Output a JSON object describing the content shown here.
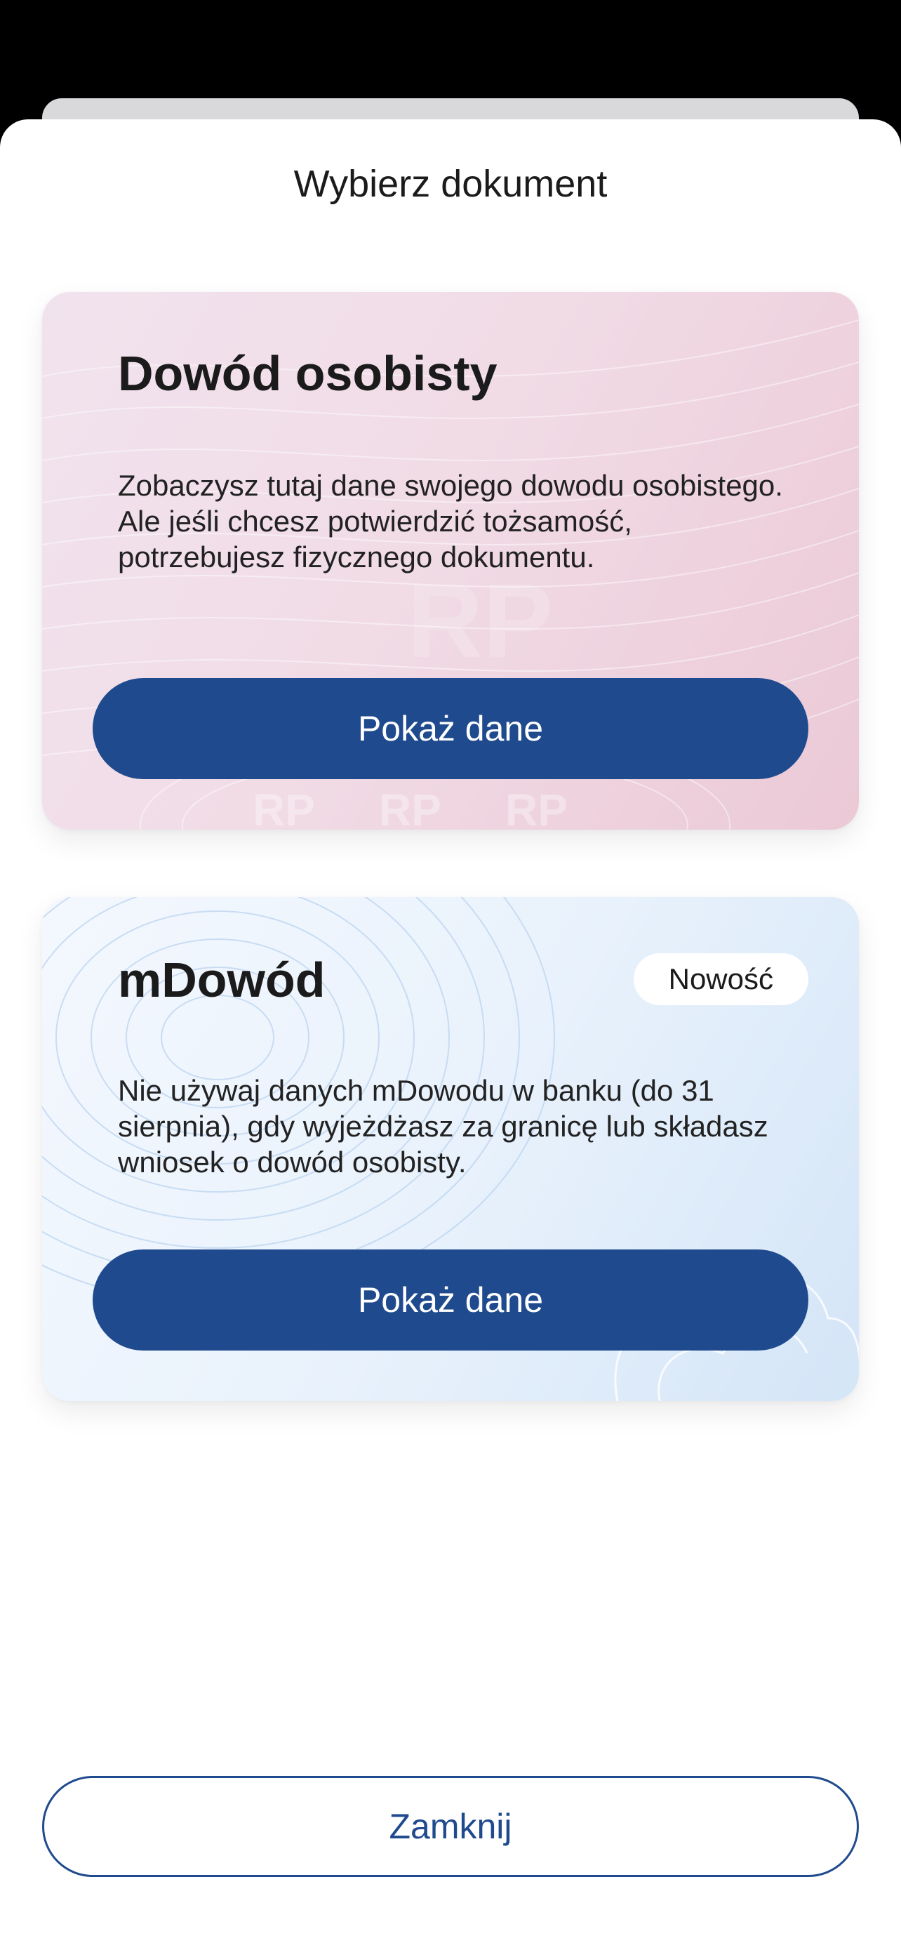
{
  "sheet": {
    "title": "Wybierz dokument",
    "close_label": "Zamknij"
  },
  "cards": [
    {
      "title": "Dowód osobisty",
      "description": "Zobaczysz tutaj dane swojego dowodu osobistego. Ale jeśli chcesz potwierdzić tożsamość, potrzebujesz fizycznego dokumentu.",
      "button_label": "Pokaż dane",
      "watermark": "RP"
    },
    {
      "title": "mDowód",
      "badge": "Nowość",
      "description": "Nie używaj danych mDowodu w banku (do 31 sierpnia), gdy wyjeżdżasz za granicę lub składasz wniosek o dowód osobisty.",
      "button_label": "Pokaż dane"
    }
  ],
  "colors": {
    "primary": "#1f4b8e",
    "id_card_bg": "#f1dce6",
    "mdowod_card_bg": "#e9f2fc"
  }
}
